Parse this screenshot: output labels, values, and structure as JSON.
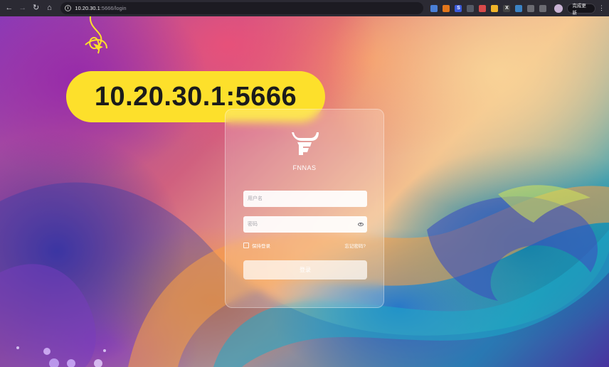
{
  "browser": {
    "url_host": "10.20.30.1",
    "url_rest": ":5666/login",
    "update_label": "完成更新",
    "extensions": [
      {
        "icon": "translate-icon",
        "color": "#4a7fd6",
        "glyph": ""
      },
      {
        "icon": "metamask-icon",
        "color": "#e2761b",
        "glyph": ""
      },
      {
        "icon": "s-extension-icon",
        "color": "#3b5bdb",
        "glyph": "S"
      },
      {
        "icon": "qr-icon",
        "color": "#555a66",
        "glyph": ""
      },
      {
        "icon": "colors-icon",
        "color": "#d94a4a",
        "glyph": ""
      },
      {
        "icon": "folder-icon",
        "color": "#f0b429",
        "glyph": ""
      },
      {
        "icon": "x-extension-icon",
        "color": "#444",
        "glyph": "X"
      },
      {
        "icon": "doc-extension-icon",
        "color": "#3b82c4",
        "glyph": ""
      },
      {
        "icon": "shield-extension-icon",
        "color": "#6b6b72",
        "glyph": ""
      },
      {
        "icon": "puzzle-icon",
        "color": "#6b6b72",
        "glyph": ""
      }
    ]
  },
  "annotation": {
    "text": "10.20.30.1:5666"
  },
  "login": {
    "brand": "FNNAS",
    "username_placeholder": "用户名",
    "password_placeholder": "密码",
    "remember_label": "保持登录",
    "forgot_label": "忘记密码?",
    "submit_label": "登录"
  }
}
